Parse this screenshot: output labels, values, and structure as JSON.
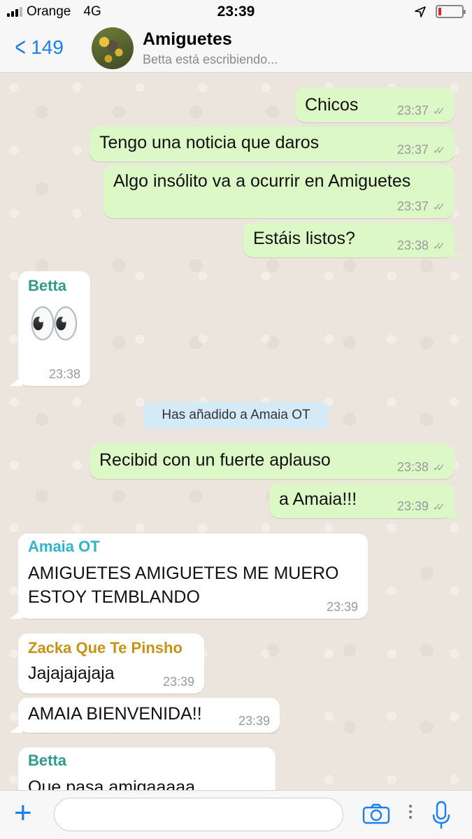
{
  "status_bar": {
    "carrier": "Orange",
    "network": "4G",
    "time": "23:39",
    "battery_level": 0.1,
    "battery_color": "#e0252a"
  },
  "header": {
    "back_count": "149",
    "title": "Amiguetes",
    "subtitle": "Betta está escribiendo...",
    "accent": "#1b7ef2"
  },
  "messages": [
    {
      "dir": "out",
      "text": "Chicos",
      "time": "23:37"
    },
    {
      "dir": "out",
      "text": "Tengo una noticia que daros",
      "time": "23:37"
    },
    {
      "dir": "out",
      "text": "Algo insólito va a ocurrir en Amiguetes",
      "time": "23:37"
    },
    {
      "dir": "out",
      "text": "Estáis listos?",
      "time": "23:38"
    },
    {
      "dir": "in",
      "sender": "Betta",
      "text": "👀",
      "time": "23:38"
    },
    {
      "dir": "system",
      "text": "Has añadido a Amaia OT"
    },
    {
      "dir": "out",
      "text": "Recibid con un fuerte aplauso",
      "time": "23:38"
    },
    {
      "dir": "out",
      "text": "a Amaia!!!",
      "time": "23:39"
    },
    {
      "dir": "in",
      "sender": "Amaia OT",
      "text_line1": "AMIGUETES AMIGUETES ME MUERO",
      "text_line2": "ESTOY TEMBLANDO",
      "time": "23:39"
    },
    {
      "dir": "in",
      "sender": "Zacka Que Te Pinsho",
      "text": "Jajajajajaja",
      "time": "23:39"
    },
    {
      "dir": "in",
      "text": "AMAIA BIENVENIDA!!",
      "time": "23:39"
    },
    {
      "dir": "in",
      "sender": "Betta",
      "text": "Que pasa amigaaaaa"
    }
  ],
  "sender_colors": {
    "Betta": "#2d9c8c",
    "Amaia OT": "#2fb5c9",
    "Zacka Que Te Pinsho": "#c89312"
  },
  "input": {
    "placeholder": ""
  },
  "colors": {
    "outgoing_bubble": "#dcf8c6",
    "incoming_bubble": "#ffffff",
    "chat_background": "#ece5dd"
  }
}
